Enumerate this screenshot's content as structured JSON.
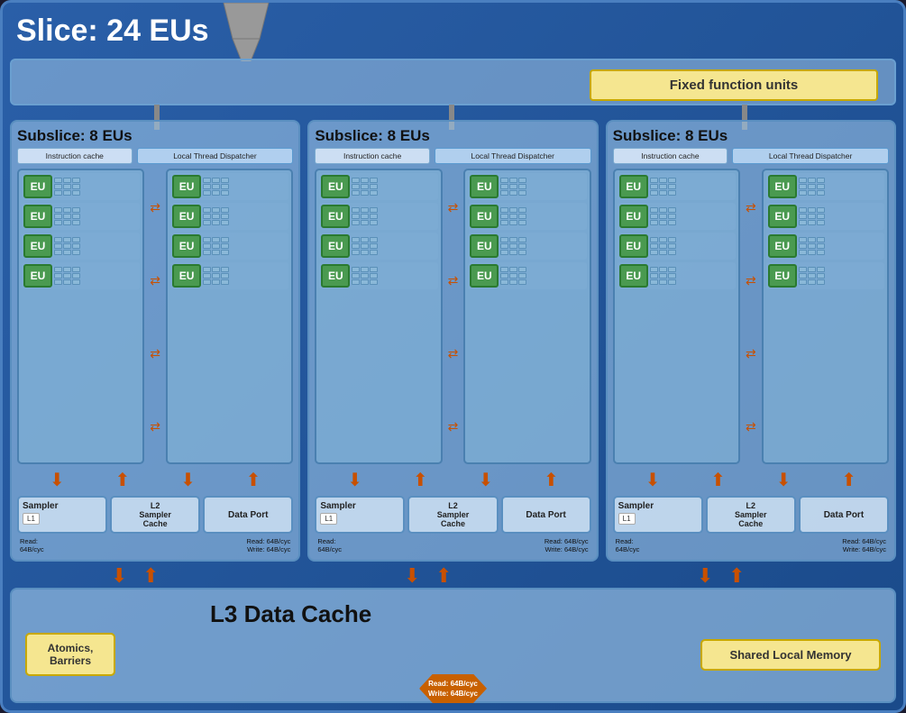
{
  "title": "Slice: 24 EUs",
  "fixed_function": "Fixed function units",
  "subslices": [
    {
      "title": "Subslice: 8 EUs",
      "instr_cache": "Instruction cache",
      "thread_dispatcher": "Local Thread Dispatcher",
      "eu_labels": [
        "EU",
        "EU",
        "EU",
        "EU",
        "EU",
        "EU",
        "EU",
        "EU"
      ],
      "sampler": "Sampler",
      "l1": "L1",
      "l2_sampler": "L2\nSampler\nCache",
      "data_port": "Data Port",
      "bw_left": "Read:\n64B/cyc",
      "bw_right": "Read: 64B/cyc\nWrite: 64B/cyc"
    },
    {
      "title": "Subslice: 8 EUs",
      "instr_cache": "Instruction cache",
      "thread_dispatcher": "Local Thread Dispatcher",
      "eu_labels": [
        "EU",
        "EU",
        "EU",
        "EU",
        "EU",
        "EU",
        "EU",
        "EU"
      ],
      "sampler": "Sampler",
      "l1": "L1",
      "l2_sampler": "L2\nSampler\nCache",
      "data_port": "Data Port",
      "bw_left": "Read:\n64B/cyc",
      "bw_right": "Read: 64B/cyc\nWrite: 64B/cyc"
    },
    {
      "title": "Subslice: 8 EUs",
      "instr_cache": "Instruction cache",
      "thread_dispatcher": "Local Thread Dispatcher",
      "eu_labels": [
        "EU",
        "EU",
        "EU",
        "EU",
        "EU",
        "EU",
        "EU",
        "EU"
      ],
      "sampler": "Sampler",
      "l1": "L1",
      "l2_sampler": "L2\nSampler\nCache",
      "data_port": "Data Port",
      "bw_left": "Read:\n64B/cyc",
      "bw_right": "Read: 64B/cyc\nWrite: 64B/cyc"
    }
  ],
  "l3_title": "L3 Data Cache",
  "atomics": "Atomics,\nBarriers",
  "shared_memory": "Shared Local Memory",
  "bottom_bw": "Read: 64B/cyc\nWrite: 64B/cyc"
}
